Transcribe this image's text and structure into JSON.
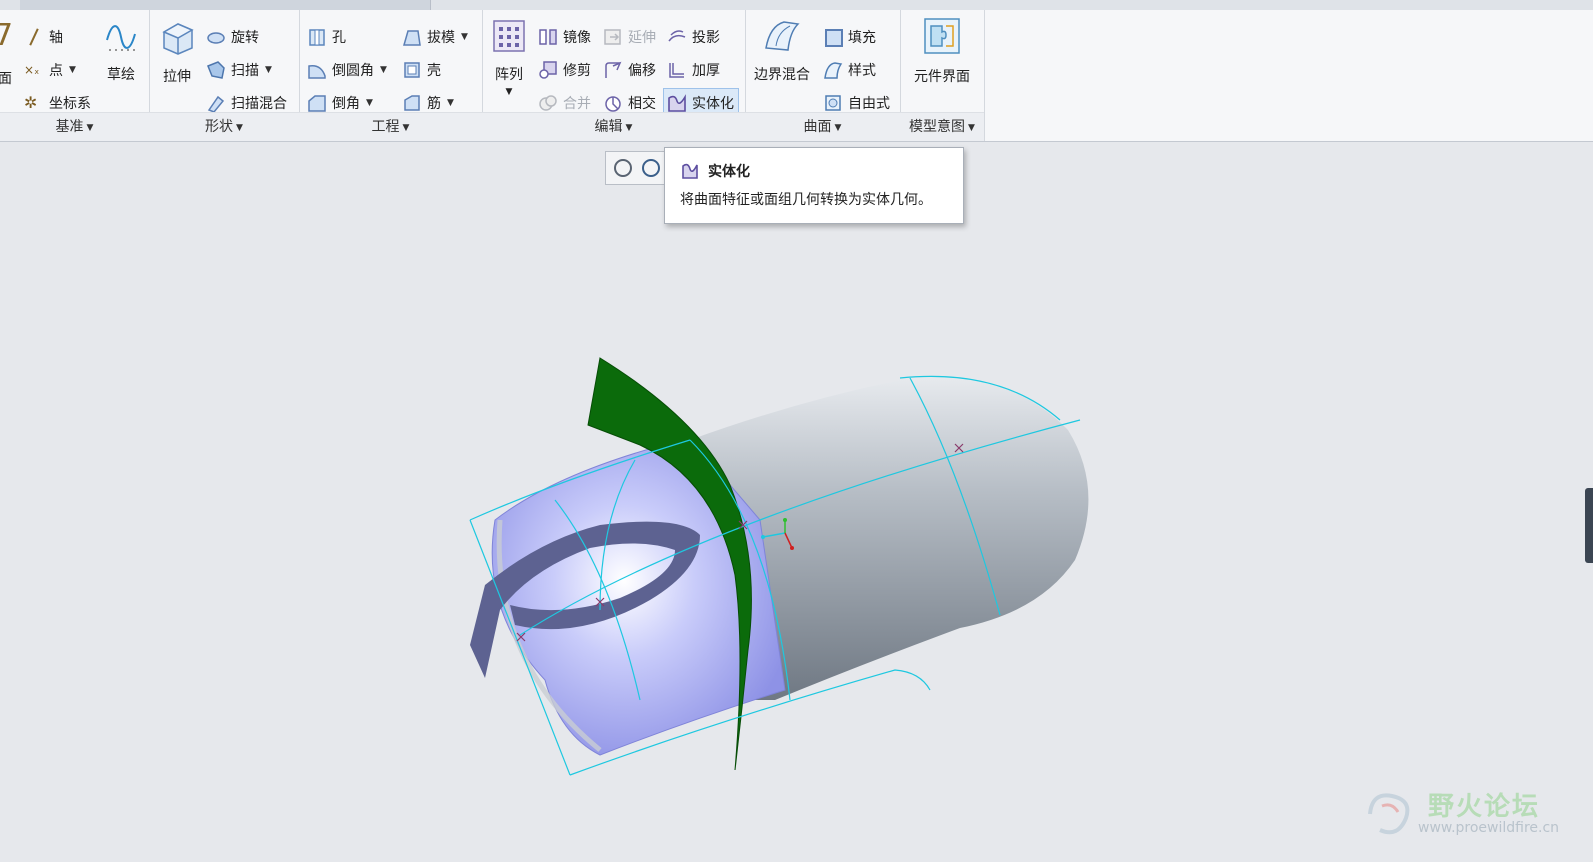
{
  "ribbon": {
    "datum": {
      "label": "基准",
      "plane_partial": "面",
      "axis": "轴",
      "point": "点",
      "csys": "坐标系",
      "sketch": "草绘"
    },
    "shapes": {
      "label": "形状",
      "extrude": "拉伸",
      "revolve": "旋转",
      "sweep": "扫描",
      "swept_blend": "扫描混合"
    },
    "engineering": {
      "label": "工程",
      "hole": "孔",
      "round": "倒圆角",
      "chamfer": "倒角",
      "draft": "拔模",
      "shell": "壳",
      "rib": "筋"
    },
    "editing": {
      "label": "编辑",
      "pattern": "阵列",
      "mirror": "镜像",
      "extend": "延伸",
      "project": "投影",
      "trim": "修剪",
      "offset": "偏移",
      "thicken": "加厚",
      "merge": "合并",
      "intersect": "相交",
      "solidify": "实体化"
    },
    "surfaces": {
      "label": "曲面",
      "boundary_blend": "边界混合",
      "fill": "填充",
      "style": "样式",
      "freestyle": "自由式"
    },
    "model_intent": {
      "label": "模型意图",
      "component_interface": "元件界面"
    }
  },
  "tooltip": {
    "title": "实体化",
    "body": "将曲面特征或面组几何转换为实体几何。"
  },
  "watermark": {
    "title": "野火论坛",
    "url": "www.proewildfire.cn"
  },
  "colors": {
    "ribbon_bg": "#f6f7f9",
    "viewport_bg": "#e6e8ec",
    "surface_green": "#0b6b0b",
    "surface_blue": "#a9acf2",
    "solid_gray": "#9aa3ad",
    "edge_cyan": "#1ec8e0"
  }
}
